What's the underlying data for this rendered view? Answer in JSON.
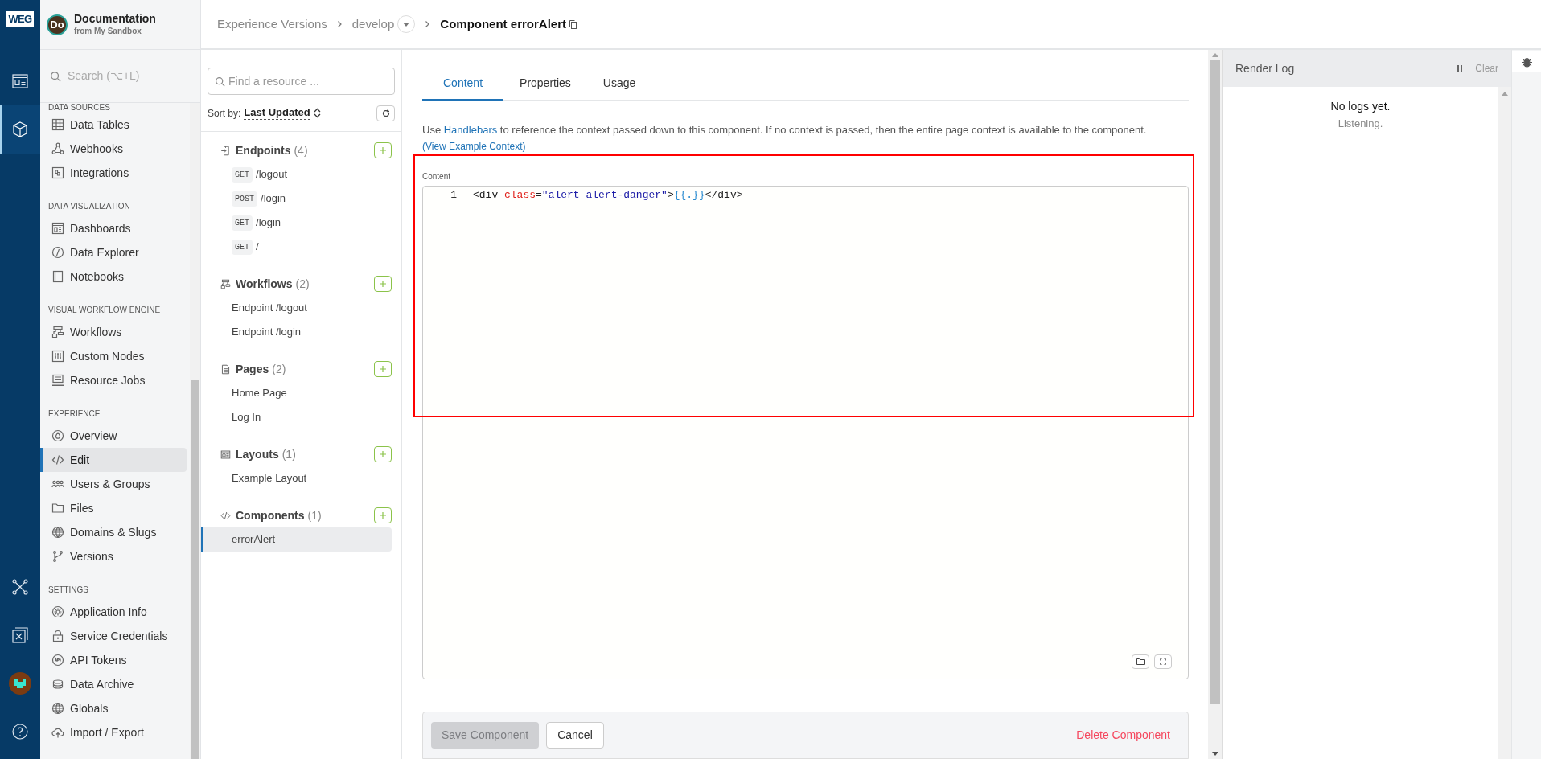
{
  "rail": {
    "logo": "WEG",
    "items": [
      {
        "kind": "dashboard",
        "selected": false
      },
      {
        "kind": "cube",
        "selected": true
      }
    ],
    "bottom_items": [
      {
        "kind": "network",
        "selected": false
      },
      {
        "kind": "diagram",
        "selected": false
      },
      {
        "kind": "avatar",
        "selected": false
      },
      {
        "kind": "help",
        "selected": false
      }
    ]
  },
  "app": {
    "initials": "Do",
    "title": "Documentation",
    "subtitle": "from My Sandbox"
  },
  "search": {
    "placeholder": "Search (⌥+L)"
  },
  "nav": [
    {
      "heading": "DATA SOURCES",
      "items": [
        {
          "kind": "table",
          "label": "Data Tables",
          "selected": false
        },
        {
          "kind": "webhook",
          "label": "Webhooks",
          "selected": false
        },
        {
          "kind": "puzzle",
          "label": "Integrations",
          "selected": false
        }
      ]
    },
    {
      "heading": "DATA VISUALIZATION",
      "items": [
        {
          "kind": "dashboard",
          "label": "Dashboards",
          "selected": false
        },
        {
          "kind": "compass",
          "label": "Data Explorer",
          "selected": false
        },
        {
          "kind": "notebook",
          "label": "Notebooks",
          "selected": false
        }
      ]
    },
    {
      "heading": "VISUAL WORKFLOW ENGINE",
      "items": [
        {
          "kind": "workflow",
          "label": "Workflows",
          "selected": false
        },
        {
          "kind": "sliders",
          "label": "Custom Nodes",
          "selected": false
        },
        {
          "kind": "server",
          "label": "Resource Jobs",
          "selected": false
        }
      ]
    },
    {
      "heading": "EXPERIENCE",
      "items": [
        {
          "kind": "drop",
          "label": "Overview",
          "selected": false
        },
        {
          "kind": "code",
          "label": "Edit",
          "selected": true
        },
        {
          "kind": "users",
          "label": "Users & Groups",
          "selected": false
        },
        {
          "kind": "folder",
          "label": "Files",
          "selected": false
        },
        {
          "kind": "globe",
          "label": "Domains & Slugs",
          "selected": false
        },
        {
          "kind": "branch",
          "label": "Versions",
          "selected": false
        }
      ]
    },
    {
      "heading": "SETTINGS",
      "items": [
        {
          "kind": "gear",
          "label": "Application Info",
          "selected": false
        },
        {
          "kind": "lock",
          "label": "Service Credentials",
          "selected": false
        },
        {
          "kind": "token",
          "label": "API Tokens",
          "selected": false
        },
        {
          "kind": "database",
          "label": "Data Archive",
          "selected": false
        },
        {
          "kind": "globe",
          "label": "Globals",
          "selected": false
        },
        {
          "kind": "cloud",
          "label": "Import / Export",
          "selected": false
        }
      ]
    }
  ],
  "breadcrumb": [
    {
      "kind": "link",
      "label": "Experience Versions"
    },
    {
      "kind": "dropdown",
      "label": "develop"
    },
    {
      "kind": "current",
      "label": "Component errorAlert"
    }
  ],
  "resources": {
    "placeholder": "Find a resource ...",
    "sort_label": "Sort by:",
    "sort_value": "Last Updated",
    "groups": [
      {
        "kind": "endpoint",
        "title": "Endpoints",
        "count": "(4)",
        "items": [
          {
            "method": "GET",
            "label": "/logout",
            "selected": false
          },
          {
            "method": "POST",
            "label": "/login",
            "selected": false
          },
          {
            "method": "GET",
            "label": "/login",
            "selected": false
          },
          {
            "method": "GET",
            "label": "/",
            "selected": false
          }
        ]
      },
      {
        "kind": "workflow",
        "title": "Workflows",
        "count": "(2)",
        "items": [
          {
            "label": "Endpoint /logout",
            "selected": false
          },
          {
            "label": "Endpoint /login",
            "selected": false
          }
        ]
      },
      {
        "kind": "page",
        "title": "Pages",
        "count": "(2)",
        "items": [
          {
            "label": "Home Page",
            "selected": false
          },
          {
            "label": "Log In",
            "selected": false
          }
        ]
      },
      {
        "kind": "layout",
        "title": "Layouts",
        "count": "(1)",
        "items": [
          {
            "label": "Example Layout",
            "selected": false
          }
        ]
      },
      {
        "kind": "code",
        "title": "Components",
        "count": "(1)",
        "items": [
          {
            "label": "errorAlert",
            "selected": true
          }
        ]
      }
    ]
  },
  "tabs": [
    {
      "label": "Content",
      "selected": true
    },
    {
      "label": "Properties",
      "selected": false
    },
    {
      "label": "Usage",
      "selected": false
    }
  ],
  "description": {
    "lead": "Use ",
    "link": "Handlebars",
    "rest": " to reference the context passed down to this component. If no context is passed, then the entire page context is available to the component."
  },
  "example_link": "(View Example Context)",
  "editor": {
    "label": "Content",
    "lines": [
      {
        "number": "1",
        "tokens": [
          {
            "kind": "tag",
            "text": "<div "
          },
          {
            "kind": "attr",
            "text": "class"
          },
          {
            "kind": "tag",
            "text": "="
          },
          {
            "kind": "string",
            "text": "\"alert alert-danger\""
          },
          {
            "kind": "tag",
            "text": ">"
          },
          {
            "kind": "handlebars",
            "text": "{{.}}"
          },
          {
            "kind": "tag",
            "text": "</div>"
          }
        ]
      }
    ]
  },
  "footer": {
    "save": "Save Component",
    "save_disabled": true,
    "cancel": "Cancel",
    "delete": "Delete Component"
  },
  "render_log": {
    "title": "Render Log",
    "clear": "Clear",
    "empty": "No logs yet.",
    "status": "Listening."
  }
}
